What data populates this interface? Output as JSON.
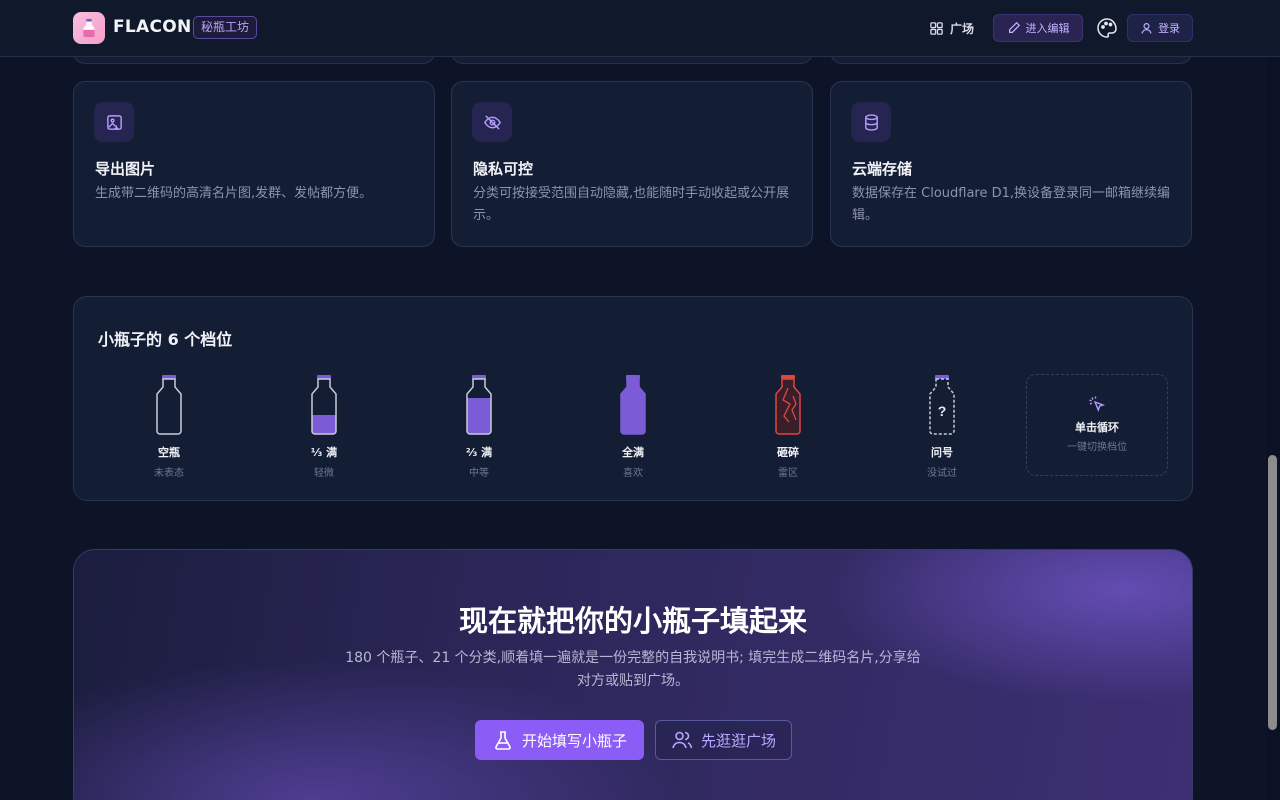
{
  "header": {
    "brand": "FLACON",
    "tag": "秘瓶工坊",
    "nav_plaza": "广场",
    "edit_button": "进入编辑",
    "login_button": "登录"
  },
  "features": [
    {
      "title": "导出图片",
      "desc": "生成带二维码的高清名片图,发群、发帖都方便。",
      "icon": "image-export-icon"
    },
    {
      "title": "隐私可控",
      "desc": "分类可按接受范围自动隐藏,也能随时手动收起或公开展示。",
      "icon": "eye-off-icon"
    },
    {
      "title": "云端存储",
      "desc": "数据保存在 Cloudflare D1,换设备登录同一邮箱继续编辑。",
      "icon": "database-icon"
    }
  ],
  "levels": {
    "title": "小瓶子的 6 个档位",
    "items": [
      {
        "name": "空瓶",
        "sub": "未表态",
        "fill": 0
      },
      {
        "name": "⅓ 满",
        "sub": "轻微",
        "fill": 0.33
      },
      {
        "name": "⅔ 满",
        "sub": "中等",
        "fill": 0.67
      },
      {
        "name": "全满",
        "sub": "喜欢",
        "fill": 1
      },
      {
        "name": "砸碎",
        "sub": "雷区",
        "fill": 0
      },
      {
        "name": "问号",
        "sub": "没试过",
        "fill": 0
      }
    ],
    "cycle": {
      "name": "单击循环",
      "sub": "一键切换档位"
    }
  },
  "cta": {
    "title": "现在就把你的小瓶子填起来",
    "desc": "180 个瓶子、21 个分类,顺着填一遍就是一份完整的自我说明书; 填完生成二维码名片,分享给对方或贴到广场。",
    "primary": "开始填写小瓶子",
    "secondary": "先逛逛广场"
  },
  "colors": {
    "accent": "#8b5cf6",
    "bottle_fill": "#7c5cd6",
    "broken": "#e0463f",
    "background": "#0d1428"
  }
}
